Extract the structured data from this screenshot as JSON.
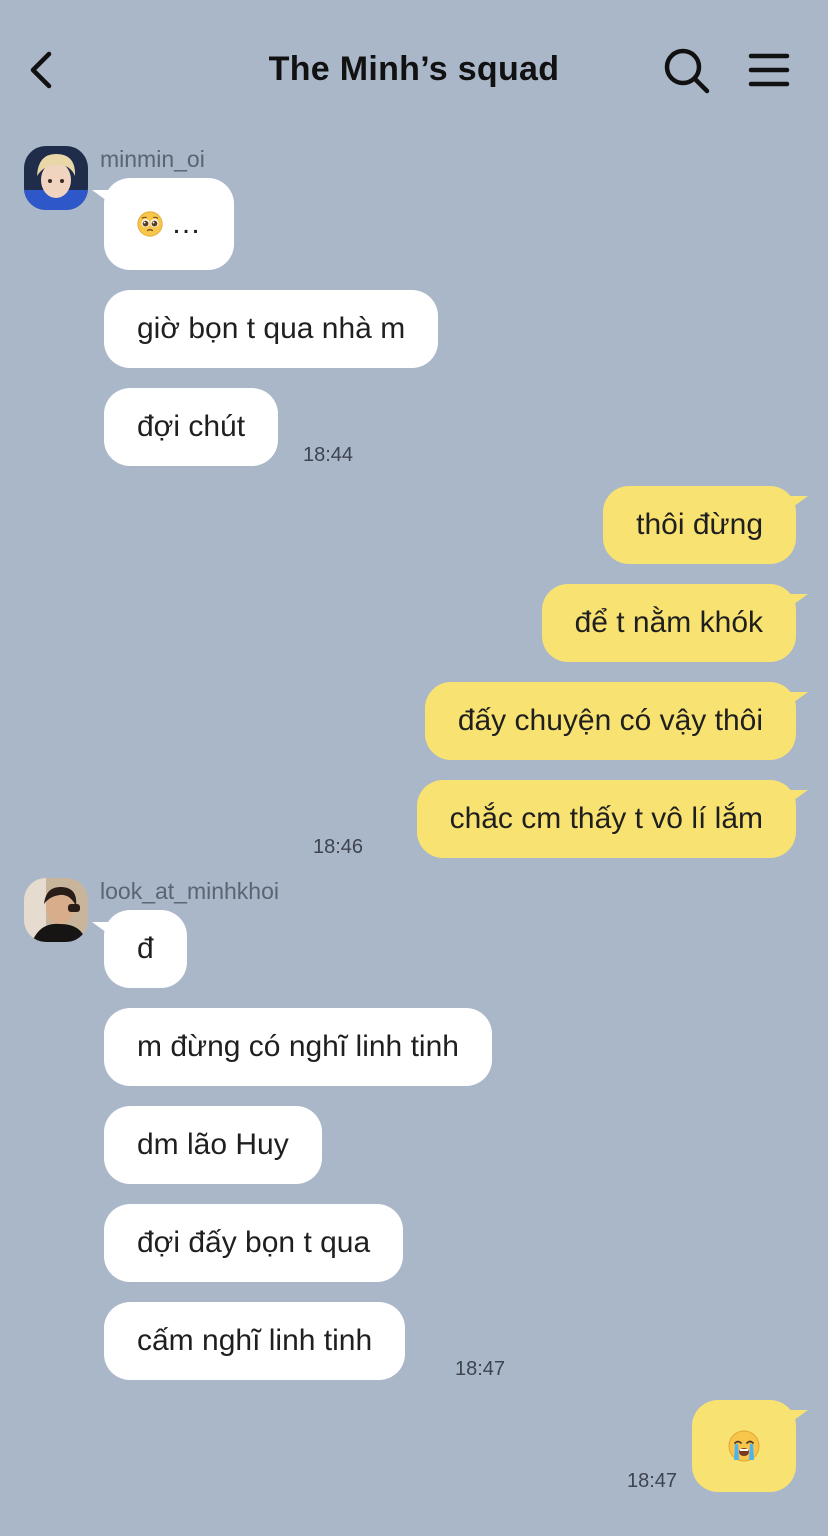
{
  "header": {
    "title": "The Minh’s squad",
    "back_icon": "chevron-left-icon",
    "search_icon": "search-icon",
    "menu_icon": "hamburger-menu-icon"
  },
  "colors": {
    "background": "#aab7c9",
    "incoming_bubble": "#ffffff",
    "outgoing_bubble": "#f8e271"
  },
  "groups": [
    {
      "sender": "minmin_oi",
      "messages": [
        "…",
        "giờ bọn t qua nhà m",
        "đợi chút"
      ],
      "time": "18:44"
    },
    {
      "sender": "me",
      "messages": [
        "thôi đừng",
        "để t nằm khók",
        "đấy chuyện có vậy thôi",
        "chắc cm thấy t vô lí lắm"
      ],
      "time": "18:46"
    },
    {
      "sender": "look_at_minhkhoi",
      "messages": [
        "đ",
        "m đừng có nghĩ linh tinh",
        "dm lão Huy",
        "đợi đấy bọn t qua",
        "cấm nghĩ linh tinh"
      ],
      "time": "18:47"
    },
    {
      "sender": "me",
      "messages": [
        ""
      ],
      "time": "18:47"
    }
  ]
}
